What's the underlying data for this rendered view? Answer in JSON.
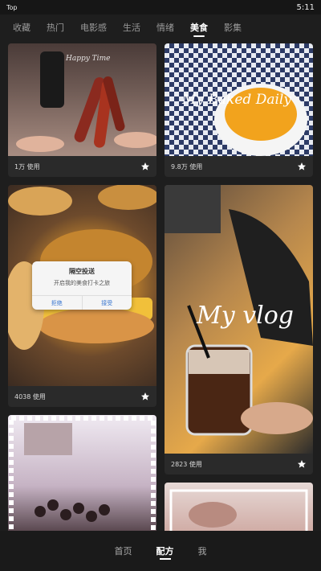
{
  "status": {
    "left": "Top",
    "time": "5:11"
  },
  "tabs": [
    "收藏",
    "热门",
    "电影感",
    "生活",
    "情绪",
    "美食",
    "影集"
  ],
  "active_tab_index": 5,
  "cards": [
    {
      "overlay": "Happy Time",
      "uses": "1万 使用"
    },
    {
      "overlay": "My Baked Daily",
      "uses": "9.8万 使用"
    },
    {
      "uses": "4038 使用",
      "dialog": {
        "title": "隔空投送",
        "message": "开启我的美食打卡之旅",
        "cancel": "拒绝",
        "accept": "接受"
      }
    },
    {
      "overlay": "My vlog",
      "uses": "2823 使用"
    },
    {
      "uses": ""
    },
    {
      "uses": ""
    }
  ],
  "bottom_nav": {
    "items": [
      "首页",
      "配方",
      "我"
    ],
    "active_index": 1
  },
  "colors": {
    "background": "#1e1e1e",
    "card": "#2a2a2a",
    "active": "#ffffff",
    "inactive": "#9a9a9a"
  },
  "icons": {
    "favorite": "star-icon"
  }
}
